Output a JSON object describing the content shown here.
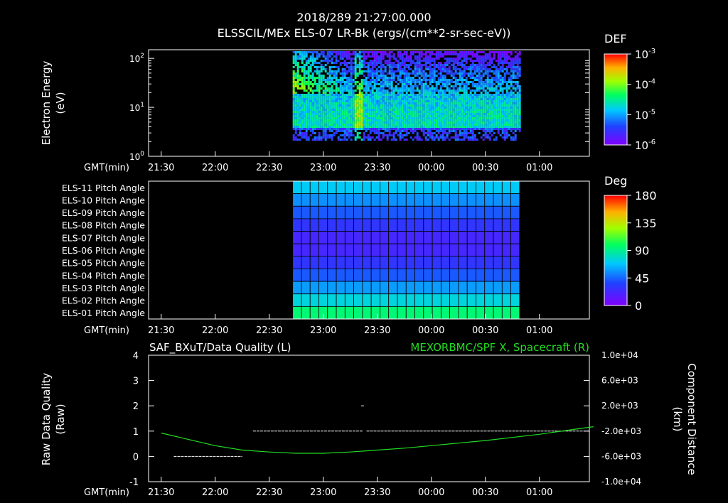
{
  "header": {
    "line1": "2018/289 21:27:00.000",
    "line2": "ELSSCIL/MEx ELS-07 LR-Bk  (ergs/(cm**2-sr-sec-eV))"
  },
  "time_axis": {
    "label": "GMT(min)",
    "ticks": [
      "21:30",
      "22:00",
      "22:30",
      "23:00",
      "23:30",
      "00:00",
      "00:30",
      "01:00"
    ]
  },
  "chart_data": [
    {
      "type": "heatmap",
      "name": "spectrogram",
      "ylabel": "Electron Energy",
      "yunit": "(eV)",
      "yscale": "log",
      "ylim": [
        1,
        150
      ],
      "yticks": [
        {
          "base": "10",
          "exp": "0",
          "value": 1
        },
        {
          "base": "10",
          "exp": "1",
          "value": 10
        },
        {
          "base": "10",
          "exp": "2",
          "value": 100
        }
      ],
      "data_time_range": [
        "22:43",
        "00:49"
      ],
      "colorbar": {
        "title": "DEF",
        "ticks": [
          {
            "base": "10",
            "exp": "-3"
          },
          {
            "base": "10",
            "exp": "-4"
          },
          {
            "base": "10",
            "exp": "-5"
          },
          {
            "base": "10",
            "exp": "-6"
          }
        ]
      },
      "colors": {
        "high": "#ff2000",
        "mid": "#00ff40",
        "low": "#6000ff"
      }
    },
    {
      "type": "heatmap",
      "name": "pitch-angle",
      "rows": [
        "ELS-11 Pitch Angle",
        "ELS-10 Pitch Angle",
        "ELS-09 Pitch Angle",
        "ELS-08 Pitch Angle",
        "ELS-07 Pitch Angle",
        "ELS-06 Pitch Angle",
        "ELS-05 Pitch Angle",
        "ELS-04 Pitch Angle",
        "ELS-03 Pitch Angle",
        "ELS-02 Pitch Angle",
        "ELS-01 Pitch Angle"
      ],
      "row_values_deg": [
        70,
        55,
        42,
        30,
        22,
        22,
        30,
        42,
        58,
        75,
        95
      ],
      "columns": 26,
      "data_time_range": [
        "22:43",
        "00:49"
      ],
      "colorbar": {
        "title": "Deg",
        "ticks": [
          "180",
          "135",
          "90",
          "45",
          "0"
        ],
        "range": [
          0,
          180
        ]
      }
    },
    {
      "type": "line",
      "name": "data-quality",
      "left_title": "SAF_BXuT/Data Quality (L)",
      "right_title": "MEXORBMC/SPF X, Spacecraft (R)",
      "ylabel_left": "Raw Data Quality",
      "yunit_left": "(Raw)",
      "ylabel_right": "Component Distance",
      "yunit_right": "(km)",
      "left_ticks": [
        "4",
        "3",
        "2",
        "1",
        "0",
        "-1"
      ],
      "left_range": [
        -1,
        4
      ],
      "right_ticks": [
        "1.0e+04",
        "6.0e+03",
        "2.0e+03",
        "-2.0e+03",
        "-6.0e+03",
        "-1.0e+04"
      ],
      "right_range": [
        -10000,
        10000
      ],
      "quality_series": [
        {
          "t_start": "21:37",
          "t_end": "22:15",
          "value": 0
        },
        {
          "t_start": "22:21",
          "t_end": "23:22",
          "value": 1
        },
        {
          "t_start": "23:24",
          "t_end": "01:28",
          "value": 1
        },
        {
          "t_start": "23:21",
          "t_end": "23:23",
          "value": 2
        }
      ],
      "distance_series": {
        "t": [
          "21:30",
          "21:45",
          "22:00",
          "22:15",
          "22:30",
          "22:45",
          "23:00",
          "23:15",
          "23:30",
          "23:45",
          "00:00",
          "00:15",
          "00:30",
          "00:45",
          "01:00",
          "01:15",
          "01:30"
        ],
        "x_km": [
          -2300,
          -3300,
          -4300,
          -5000,
          -5300,
          -5500,
          -5500,
          -5300,
          -5000,
          -4700,
          -4300,
          -3900,
          -3500,
          -3000,
          -2500,
          -1900,
          -1300
        ]
      },
      "colors": {
        "quality": "#ffffff",
        "distance": "#22dd22",
        "right_title": "#22dd22"
      }
    }
  ]
}
